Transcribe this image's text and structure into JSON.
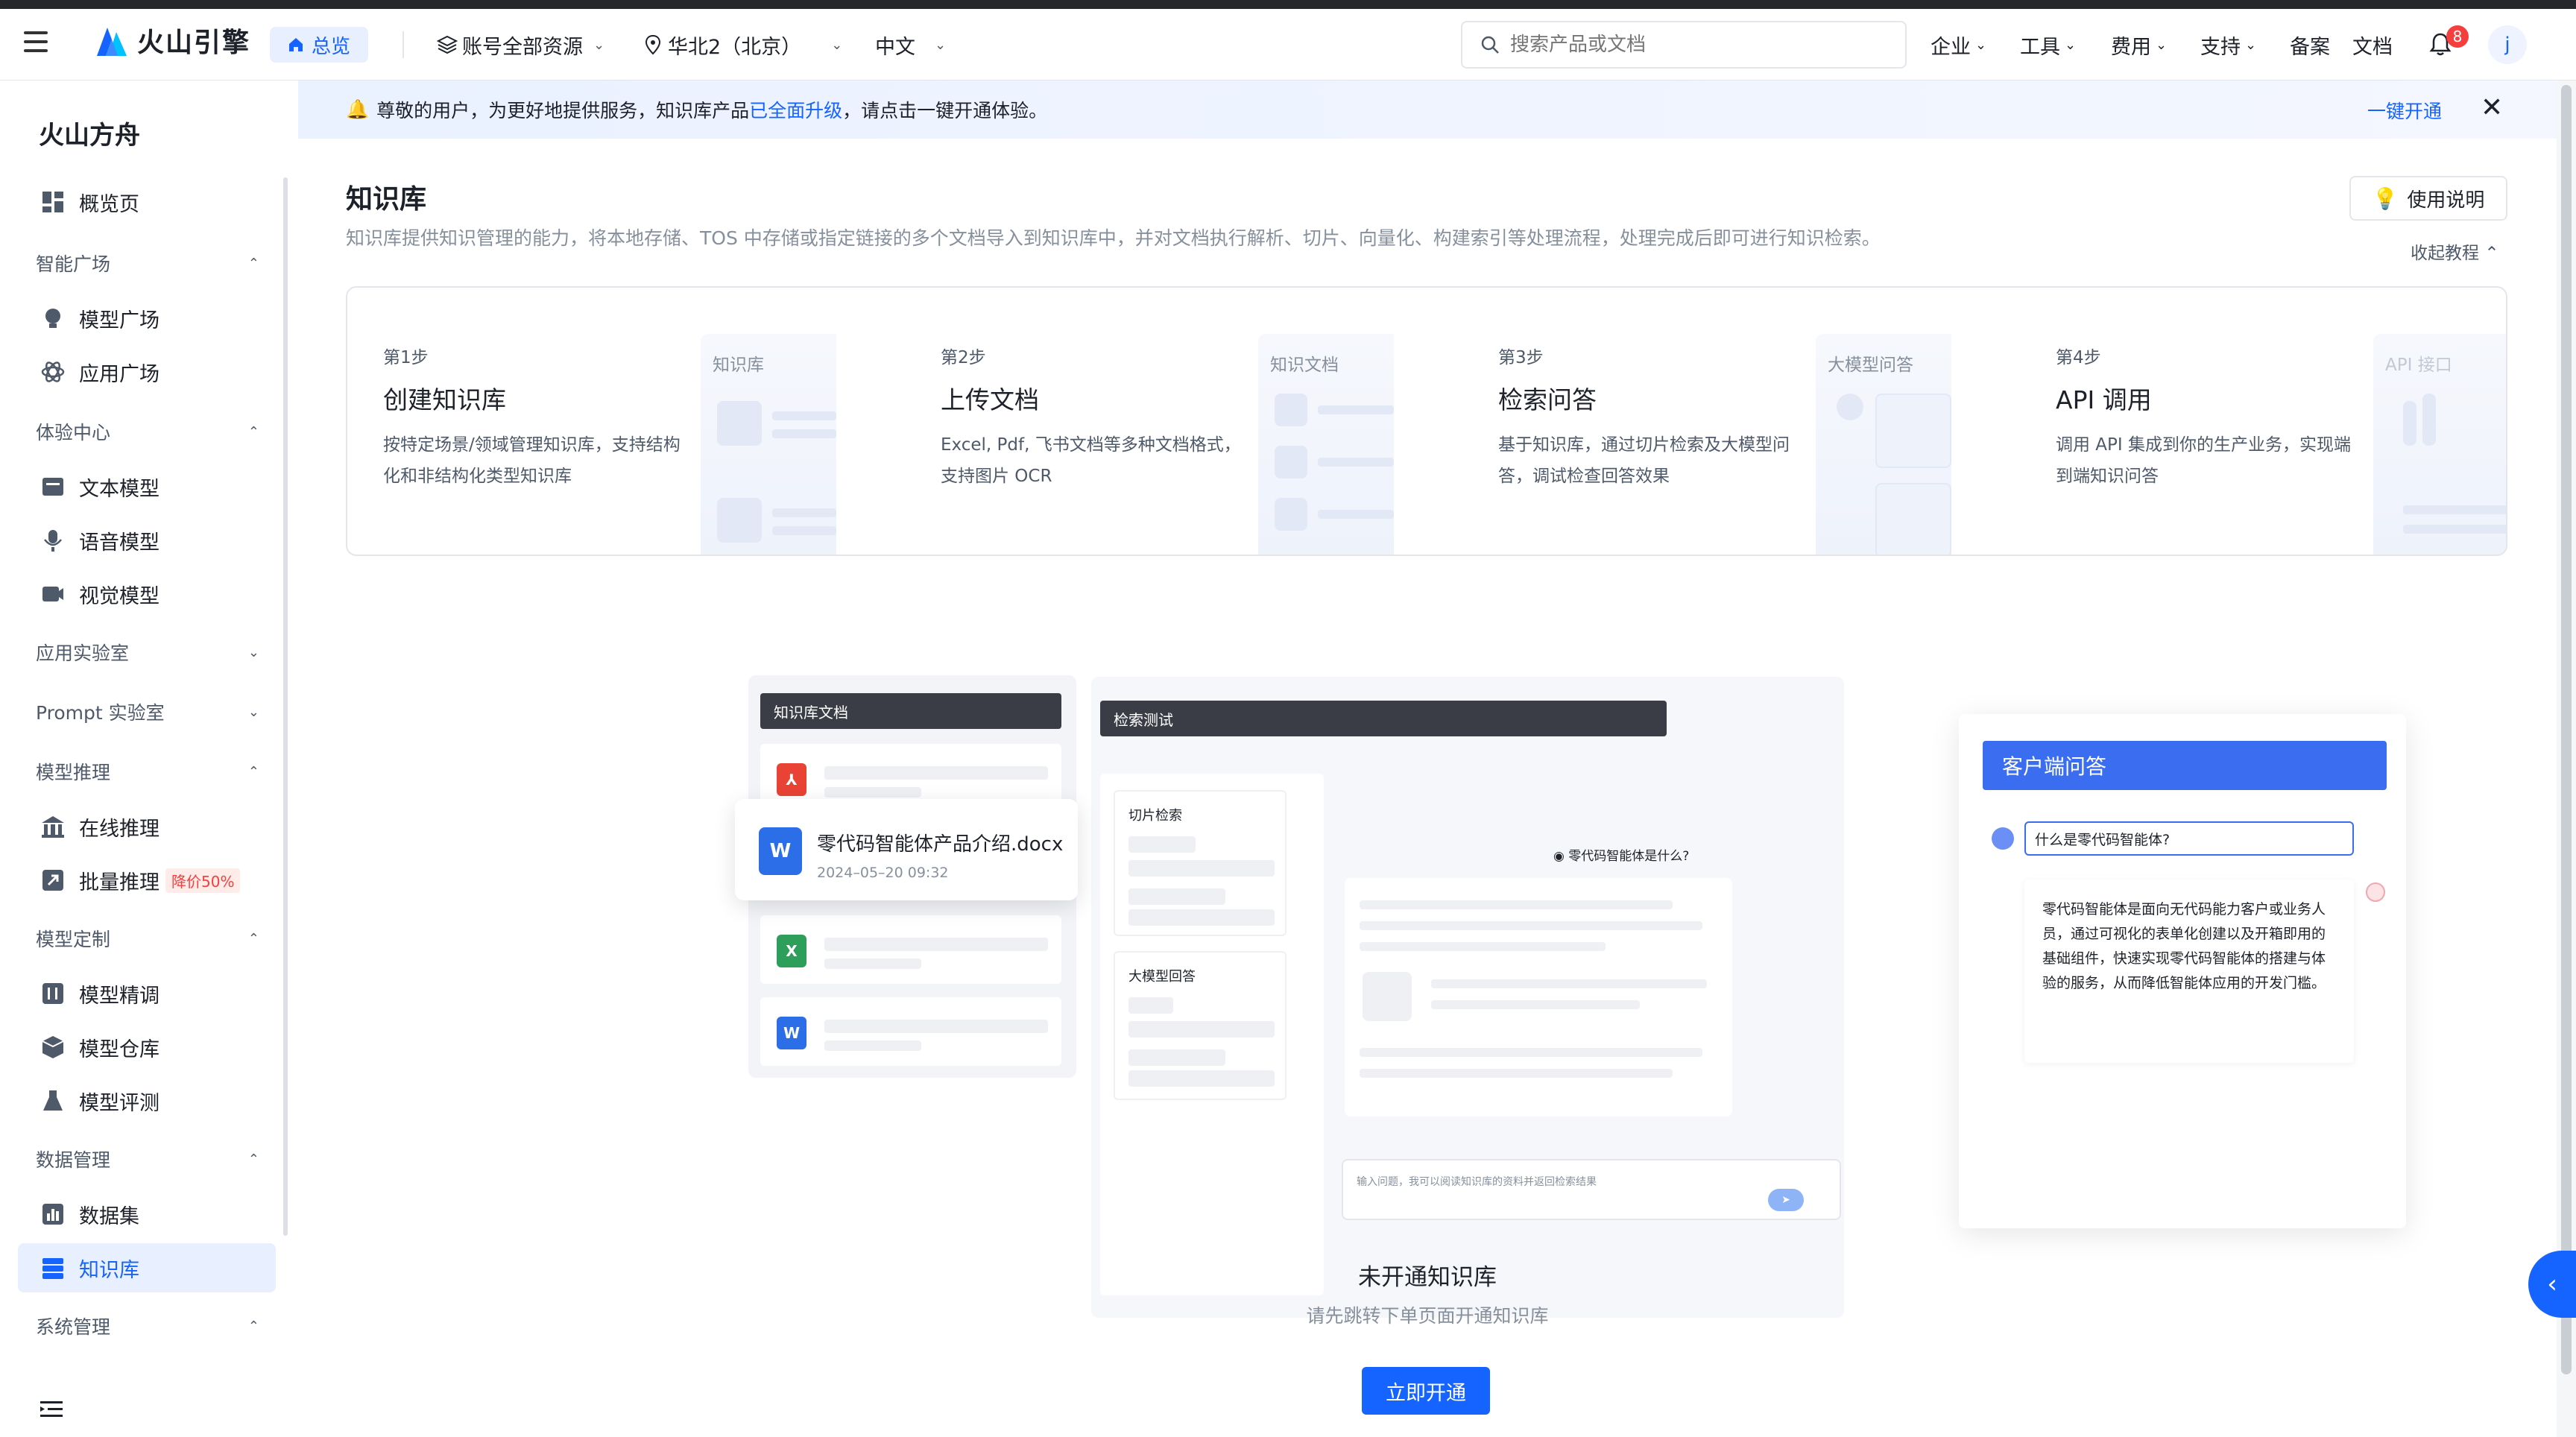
{
  "header": {
    "brand": "火山引擎",
    "home_chip": "总览",
    "account_scope": "账号全部资源",
    "region": "华北2（北京）",
    "language": "中文",
    "search_placeholder": "搜索产品或文档",
    "nav": [
      "企业",
      "工具",
      "费用",
      "支持",
      "备案",
      "文档"
    ],
    "notification_count": "8",
    "avatar_letter": "j"
  },
  "sidebar": {
    "title": "火山方舟",
    "overview": "概览页",
    "groups": {
      "g1": "智能广场",
      "g2": "体验中心",
      "g3": "应用实验室",
      "g4": "Prompt 实验室",
      "g5": "模型推理",
      "g6": "模型定制",
      "g7": "数据管理",
      "g8": "系统管理"
    },
    "items": {
      "model_square": "模型广场",
      "app_square": "应用广场",
      "text_model": "文本模型",
      "voice_model": "语音模型",
      "vision_model": "视觉模型",
      "online_inference": "在线推理",
      "batch_inference": "批量推理",
      "batch_discount": "降价50%",
      "fine_tune": "模型精调",
      "model_repo": "模型仓库",
      "model_eval": "模型评测",
      "dataset": "数据集",
      "knowledge_base": "知识库"
    }
  },
  "notice": {
    "prefix": "尊敬的用户，为更好地提供服务，知识库产品",
    "link": "已全面升级",
    "suffix": "，请点击一键开通体验。",
    "action": "一键开通",
    "close": "✕"
  },
  "page": {
    "title": "知识库",
    "description": "知识库提供知识管理的能力，将本地存储、TOS 中存储或指定链接的多个文档导入到知识库中，并对文档执行解析、切片、向量化、构建索引等处理流程，处理完成后即可进行知识检索。",
    "guide_button": "使用说明",
    "collapse_tutorial": "收起教程"
  },
  "steps": [
    {
      "num": "第1步",
      "title": "创建知识库",
      "desc": "按特定场景/领域管理知识库，支持结构化和非结构化类型知识库",
      "illus": "知识库"
    },
    {
      "num": "第2步",
      "title": "上传文档",
      "desc": "Excel, Pdf, 飞书文档等多种文档格式，支持图片 OCR",
      "illus": "知识文档"
    },
    {
      "num": "第3步",
      "title": "检索问答",
      "desc": "基于知识库，通过切片检索及大模型问答，调试检查回答效果",
      "illus": "大模型问答"
    },
    {
      "num": "第4步",
      "title": "API 调用",
      "desc": "调用 API 集成到你的生产业务，实现端到端知识问答",
      "illus": "API 接口"
    }
  ],
  "illustration": {
    "docs_panel": "知识库文档",
    "file_name": "零代码智能体产品介绍.docx",
    "file_date": "2024–05–20 09:32",
    "search_panel": "检索测试",
    "slice_search": "切片检索",
    "llm_answer": "大模型回答",
    "query": "零代码智能体是什么?",
    "input_placeholder": "输入问题，我可以阅读知识库的资料并返回检索结果",
    "chat_title": "客户端问答",
    "chat_question": "什么是零代码智能体?",
    "chat_answer": "零代码智能体是面向无代码能力客户或业务人员，通过可视化的表单化创建以及开箱即用的基础组件，快速实现零代码智能体的搭建与体验的服务，从而降低智能体应用的开发门槛。"
  },
  "empty_state": {
    "title": "未开通知识库",
    "subtitle": "请先跳转下单页面开通知识库",
    "button": "立即开通"
  },
  "colors": {
    "primary": "#1664ff",
    "active_bg": "#e8f0ff",
    "danger": "#f53f3f"
  }
}
